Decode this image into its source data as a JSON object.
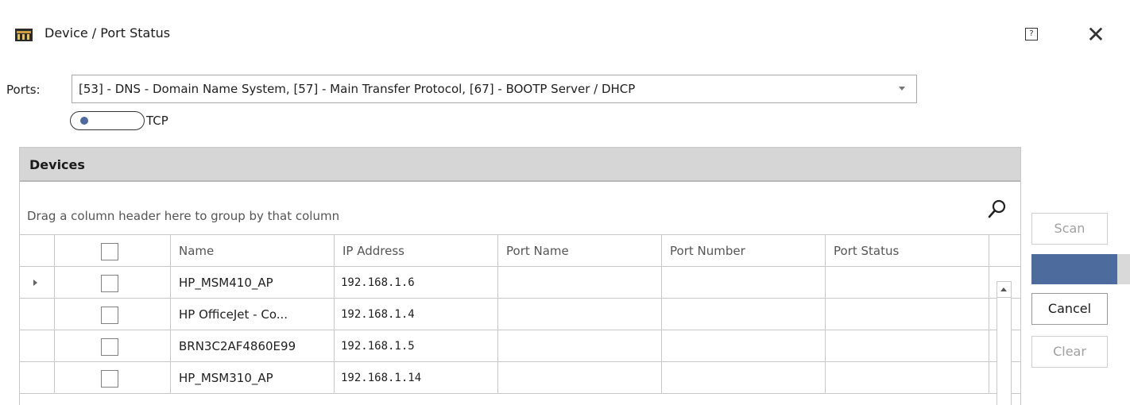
{
  "window": {
    "title": "Device / Port Status",
    "help_label": "?",
    "close_label": "✕"
  },
  "ports": {
    "label": "Ports:",
    "value": "[53] - DNS - Domain Name System, [57] - Main Transfer Protocol, [67] - BOOTP Server / DHCP"
  },
  "protocol_toggle": {
    "label": "TCP"
  },
  "devices": {
    "title": "Devices",
    "group_panel_text": "Drag a column header here to group by that column",
    "columns": [
      "Name",
      "IP Address",
      "Port Name",
      "Port Number",
      "Port Status"
    ],
    "rows": [
      {
        "name": "HP_MSM410_AP",
        "ip": "192.168.1.6",
        "port_name": "",
        "port_number": "",
        "port_status": ""
      },
      {
        "name": "HP OfficeJet - Co...",
        "ip": "192.168.1.4",
        "port_name": "",
        "port_number": "",
        "port_status": ""
      },
      {
        "name": "BRN3C2AF4860E99",
        "ip": "192.168.1.5",
        "port_name": "",
        "port_number": "",
        "port_status": ""
      },
      {
        "name": "HP_MSM310_AP",
        "ip": "192.168.1.14",
        "port_name": "",
        "port_number": "",
        "port_status": ""
      }
    ]
  },
  "actions": {
    "scan_label": "Scan",
    "cancel_label": "Cancel",
    "clear_label": "Clear",
    "progress_fraction": 0.87
  },
  "colors": {
    "accent": "#4e6b9e",
    "group_header": "#d6d6d6"
  }
}
